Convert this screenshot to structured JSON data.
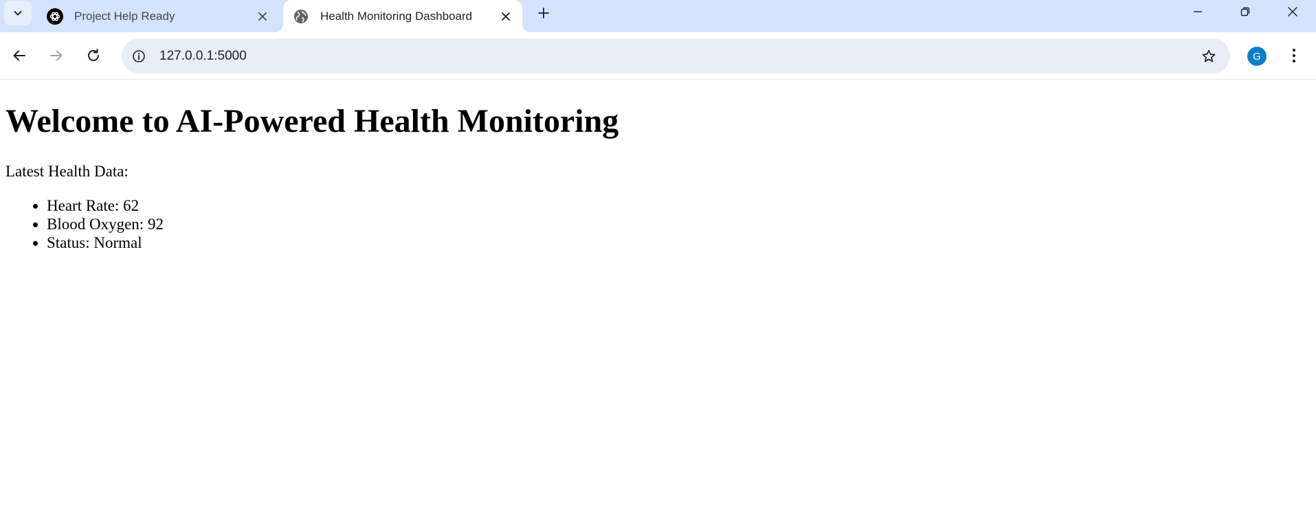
{
  "browser": {
    "tabs": [
      {
        "title": "Project Help Ready",
        "icon": "chatgpt-logo-icon",
        "active": false
      },
      {
        "title": "Health Monitoring Dashboard",
        "icon": "globe-icon",
        "active": true
      }
    ],
    "address_bar": {
      "url": "127.0.0.1:5000"
    },
    "profile_initial": "G"
  },
  "page": {
    "heading": "Welcome to AI-Powered Health Monitoring",
    "intro": "Latest Health Data:",
    "health_items": [
      "Heart Rate: 62",
      "Blood Oxygen: 92",
      "Status: Normal"
    ]
  }
}
